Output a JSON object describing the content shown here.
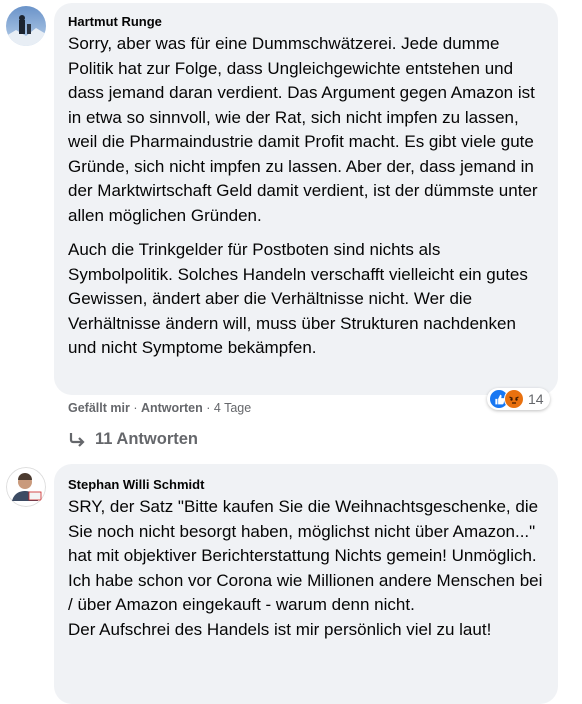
{
  "comments": [
    {
      "author": "Hartmut Runge",
      "paragraphs": [
        "Sorry, aber was für eine Dummschwätzerei. Jede dumme Politik hat zur Folge, dass Ungleichgewichte entstehen und dass jemand daran verdient. Das Argument gegen Amazon ist in etwa so sinnvoll, wie der Rat, sich nicht impfen zu lassen, weil die Pharmaindustrie damit Profit macht. Es gibt viele gute Gründe, sich nicht impfen zu lassen. Aber der, dass jemand in der Marktwirtschaft Geld damit verdient, ist der dümmste unter allen möglichen Gründen.",
        "Auch die Trinkgelder für Postboten sind nichts als Symbolpolitik. Solches Handeln verschafft vielleicht ein gutes Gewissen, ändert aber die Verhältnisse nicht. Wer die Verhältnisse ändern will, muss über Strukturen nachdenken und nicht Symptome bekämpfen."
      ],
      "like_label": "Gefällt mir",
      "reply_label": "Antworten",
      "age": "4 Tage",
      "reaction_count": "14",
      "replies_label": "11 Antworten"
    },
    {
      "author": "Stephan Willi Schmidt",
      "paragraphs": [
        "SRY, der Satz \"Bitte kaufen Sie die Weihnachtsgeschenke, die Sie noch nicht besorgt haben, möglichst nicht über Amazon...\" hat mit objektiver Berichterstattung Nichts gemein! Unmöglich. Ich habe schon vor Corona wie Millionen andere Menschen bei / über Amazon eingekauft - warum denn nicht.",
        "Der Aufschrei des Handels ist mir persönlich viel zu laut!"
      ]
    }
  ],
  "separator": "·",
  "icons": {
    "reply_arrow": "reply-arrow-icon",
    "like": "like-reaction-icon",
    "angry": "angry-reaction-icon"
  },
  "colors": {
    "bubble": "#f0f2f5",
    "meta_text": "#65676b",
    "like_blue": "#1877f2",
    "angry_orange": "#e9710f"
  }
}
